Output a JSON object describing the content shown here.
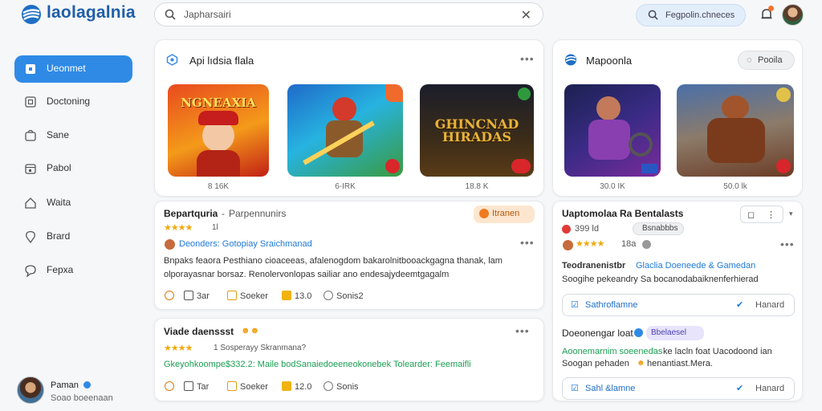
{
  "app": {
    "logo_text": "laolagalnia"
  },
  "search": {
    "value": "Japharsairi"
  },
  "header": {
    "secondary_search": "Fegpolin.chneces"
  },
  "sidebar": {
    "items": [
      {
        "label": "Ueonmet",
        "icon": "home-icon",
        "active": true
      },
      {
        "label": "Doctoning",
        "icon": "document-icon",
        "active": false
      },
      {
        "label": "Sane",
        "icon": "bag-icon",
        "active": false
      },
      {
        "label": "Pabol",
        "icon": "calendar-icon",
        "active": false
      },
      {
        "label": "Waita",
        "icon": "house-icon",
        "active": false
      },
      {
        "label": "Brard",
        "icon": "pin-icon",
        "active": false
      },
      {
        "label": "Fepxa",
        "icon": "chat-icon",
        "active": false
      }
    ]
  },
  "user": {
    "name": "Paman",
    "sub": "Soao boeenaan"
  },
  "games_panel": {
    "title": "Api lıdsia flala",
    "items": [
      {
        "art_text": "NGNEAXIA",
        "caption": "8 16K"
      },
      {
        "art_text": "",
        "caption": "6-IRK"
      },
      {
        "art_text": "GHINCNAD HIRADAS",
        "caption": "18.8 K"
      }
    ]
  },
  "mapo_panel": {
    "title": "Mapoonla",
    "button": "Pooila",
    "items": [
      {
        "caption": "30.0 IK"
      },
      {
        "caption": "50.0 lk"
      }
    ]
  },
  "reviews": [
    {
      "title": "Bepartquria",
      "subtitle": "Parpennunirs",
      "badge": "Itranen",
      "stars": "★★★★",
      "star_note": "1l",
      "author_line": "Deonders: Gotopiay Sraichmanad",
      "body_1": "Bnpaks feaora Pesthiano cioaceeas, afalenogdom bakarolnitbooackgagna thanak, lam",
      "body_2": "olporayasnar borsaz. Renolervonlopas sailiar ano endesajydeemtgagalm",
      "actions": [
        "3ar",
        "Soeker",
        "13.0",
        "Sonis2"
      ]
    },
    {
      "title": "Viade daenssst",
      "stars": "★★★★",
      "star_note": "1 Sosperayy Skranmana?",
      "body_1": "Gkeyohkoompe$332.2: Maile bodSanaiedoeeneokonebek Tolearder: Feemaifli",
      "actions": [
        "Tar",
        "Soeker",
        "12.0",
        "Sonis"
      ]
    }
  ],
  "right_cards": [
    {
      "title": "Uaptomolaa Ra Bentalasts",
      "meta_1": "399 ld",
      "meta_2": "Bsnabbbs",
      "star_note": "18a",
      "line_1a": "Teodranenistbr",
      "line_1b": "Glaclia Doeneede & Gamedan",
      "line_2": "Soogihe pekeandry Sa bocanodabaiknenferhierad",
      "button_left": "Sathroflamne",
      "button_right": "Hanard"
    },
    {
      "title": "Doeonengar loat",
      "tag": "Bbelaesel",
      "line_1a": "Aoonemarnim soeenedas",
      "line_1b": "ke lacln foat Uacodoond ian",
      "line_2": "Soogan pehaden",
      "line_2b": "henantiast.Mera.",
      "button_left": "Sahl &lamne",
      "button_right": "Hanard"
    }
  ],
  "colors": {
    "accent": "#2f8ae6",
    "badge": "#fde6cf",
    "star": "#f1a90f"
  }
}
